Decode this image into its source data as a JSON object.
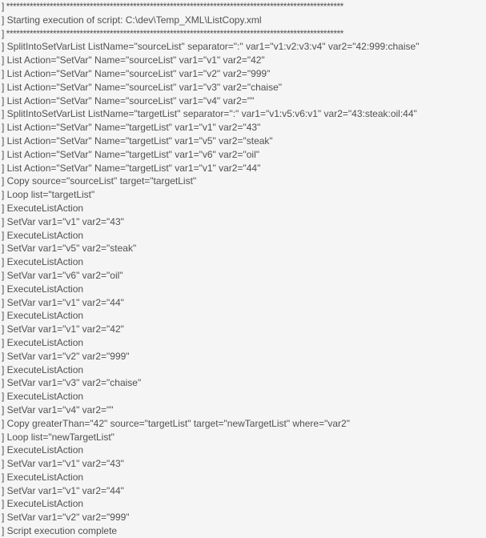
{
  "lines": [
    {
      "text": "] *****************************************************************************************************",
      "divider": true
    },
    {
      "text": "] Starting execution of script: C:\\dev\\Temp_XML\\ListCopy.xml",
      "divider": false
    },
    {
      "text": "] *****************************************************************************************************",
      "divider": true
    },
    {
      "text": "] SplitIntoSetVarList ListName=\"sourceList\" separator=\":\"  var1=\"v1:v2:v3:v4\" var2=\"42:999:chaise\"",
      "divider": false
    },
    {
      "text": "] List Action=\"SetVar\" Name=\"sourceList\" var1=\"v1\" var2=\"42\"",
      "divider": false
    },
    {
      "text": "] List Action=\"SetVar\" Name=\"sourceList\" var1=\"v2\" var2=\"999\"",
      "divider": false
    },
    {
      "text": "] List Action=\"SetVar\" Name=\"sourceList\" var1=\"v3\" var2=\"chaise\"",
      "divider": false
    },
    {
      "text": "] List Action=\"SetVar\" Name=\"sourceList\" var1=\"v4\" var2=\"\"",
      "divider": false
    },
    {
      "text": "] SplitIntoSetVarList ListName=\"targetList\" separator=\":\"  var1=\"v1:v5:v6:v1\" var2=\"43:steak:oil:44\"",
      "divider": false
    },
    {
      "text": "] List Action=\"SetVar\" Name=\"targetList\" var1=\"v1\" var2=\"43\"",
      "divider": false
    },
    {
      "text": "] List Action=\"SetVar\" Name=\"targetList\" var1=\"v5\" var2=\"steak\"",
      "divider": false
    },
    {
      "text": "] List Action=\"SetVar\" Name=\"targetList\" var1=\"v6\" var2=\"oil\"",
      "divider": false
    },
    {
      "text": "] List Action=\"SetVar\" Name=\"targetList\" var1=\"v1\" var2=\"44\"",
      "divider": false
    },
    {
      "text": "] Copy source=\"sourceList\" target=\"targetList\"",
      "divider": false
    },
    {
      "text": "] Loop list=\"targetList\"",
      "divider": false
    },
    {
      "text": "] ExecuteListAction",
      "divider": false
    },
    {
      "text": "] SetVar var1=\"v1\" var2=\"43\"",
      "divider": false
    },
    {
      "text": "] ExecuteListAction",
      "divider": false
    },
    {
      "text": "] SetVar var1=\"v5\" var2=\"steak\"",
      "divider": false
    },
    {
      "text": "] ExecuteListAction",
      "divider": false
    },
    {
      "text": "] SetVar var1=\"v6\" var2=\"oil\"",
      "divider": false
    },
    {
      "text": "] ExecuteListAction",
      "divider": false
    },
    {
      "text": "] SetVar var1=\"v1\" var2=\"44\"",
      "divider": false
    },
    {
      "text": "] ExecuteListAction",
      "divider": false
    },
    {
      "text": "] SetVar var1=\"v1\" var2=\"42\"",
      "divider": false
    },
    {
      "text": "] ExecuteListAction",
      "divider": false
    },
    {
      "text": "] SetVar var1=\"v2\" var2=\"999\"",
      "divider": false
    },
    {
      "text": "] ExecuteListAction",
      "divider": false
    },
    {
      "text": "] SetVar var1=\"v3\" var2=\"chaise\"",
      "divider": false
    },
    {
      "text": "] ExecuteListAction",
      "divider": false
    },
    {
      "text": "] SetVar var1=\"v4\" var2=\"\"",
      "divider": false
    },
    {
      "text": "] Copy greaterThan=\"42\" source=\"targetList\" target=\"newTargetList\" where=\"var2\"",
      "divider": false
    },
    {
      "text": "] Loop list=\"newTargetList\"",
      "divider": false
    },
    {
      "text": "] ExecuteListAction",
      "divider": false
    },
    {
      "text": "] SetVar var1=\"v1\" var2=\"43\"",
      "divider": false
    },
    {
      "text": "] ExecuteListAction",
      "divider": false
    },
    {
      "text": "] SetVar var1=\"v1\" var2=\"44\"",
      "divider": false
    },
    {
      "text": "] ExecuteListAction",
      "divider": false
    },
    {
      "text": "] SetVar var1=\"v2\" var2=\"999\"",
      "divider": false
    },
    {
      "text": "] Script execution complete",
      "divider": false
    }
  ]
}
